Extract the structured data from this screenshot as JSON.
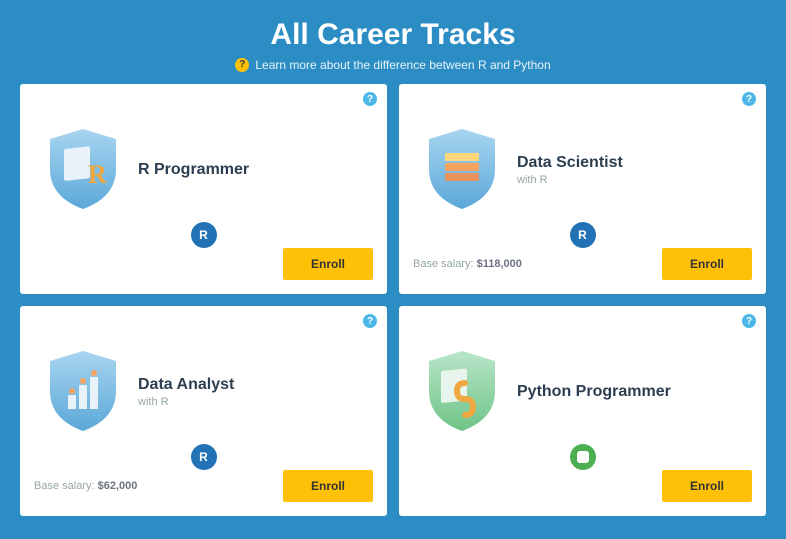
{
  "header": {
    "title": "All Career Tracks",
    "subtitle": "Learn more about the difference between R and Python"
  },
  "enroll_label": "Enroll",
  "salary_label": "Base salary:",
  "tracks": [
    {
      "title": "R Programmer",
      "subtitle": "",
      "salary": "",
      "lang": "R",
      "icon": "r-programmer-icon",
      "shield_color": "blue"
    },
    {
      "title": "Data Scientist",
      "subtitle": "with R",
      "salary": "$118,000",
      "lang": "R",
      "icon": "data-scientist-icon",
      "shield_color": "blue"
    },
    {
      "title": "Data Analyst",
      "subtitle": "with R",
      "salary": "$62,000",
      "lang": "R",
      "icon": "data-analyst-icon",
      "shield_color": "blue"
    },
    {
      "title": "Python Programmer",
      "subtitle": "",
      "salary": "",
      "lang": "Python",
      "icon": "python-programmer-icon",
      "shield_color": "green"
    }
  ]
}
